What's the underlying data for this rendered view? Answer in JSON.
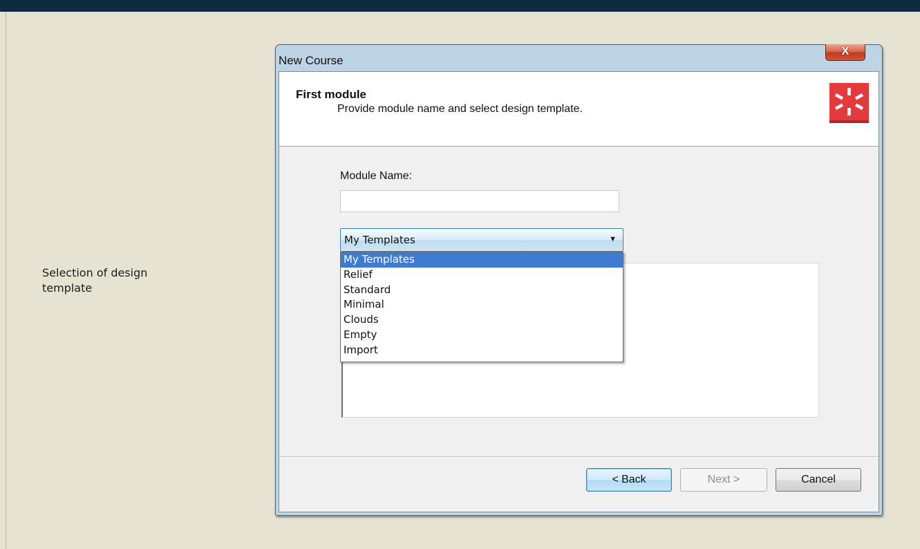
{
  "page": {
    "caption": [
      "Selection of design",
      "template"
    ]
  },
  "dialog": {
    "title": "New Course",
    "close_label": "X",
    "header": {
      "title": "First module",
      "subtitle": "Provide module name and select design template."
    },
    "module_name": {
      "label": "Module Name:",
      "value": ""
    },
    "template_select": {
      "selected": "My Templates",
      "options": [
        "My Templates",
        "Relief",
        "Standard",
        "Minimal",
        "Clouds",
        "Empty",
        "Import"
      ],
      "highlighted": "My Templates"
    },
    "buttons": {
      "back": "< Back",
      "next": "Next >",
      "cancel": "Cancel"
    }
  },
  "colors": {
    "page_background": "#e7e3d3",
    "top_bar": "#0f2b3f",
    "logo_red": "#e33a3d",
    "highlight": "#3d7cd1"
  },
  "icons": {
    "logo": "starburst-logo-icon",
    "dropdown": "chevron-down-icon"
  }
}
